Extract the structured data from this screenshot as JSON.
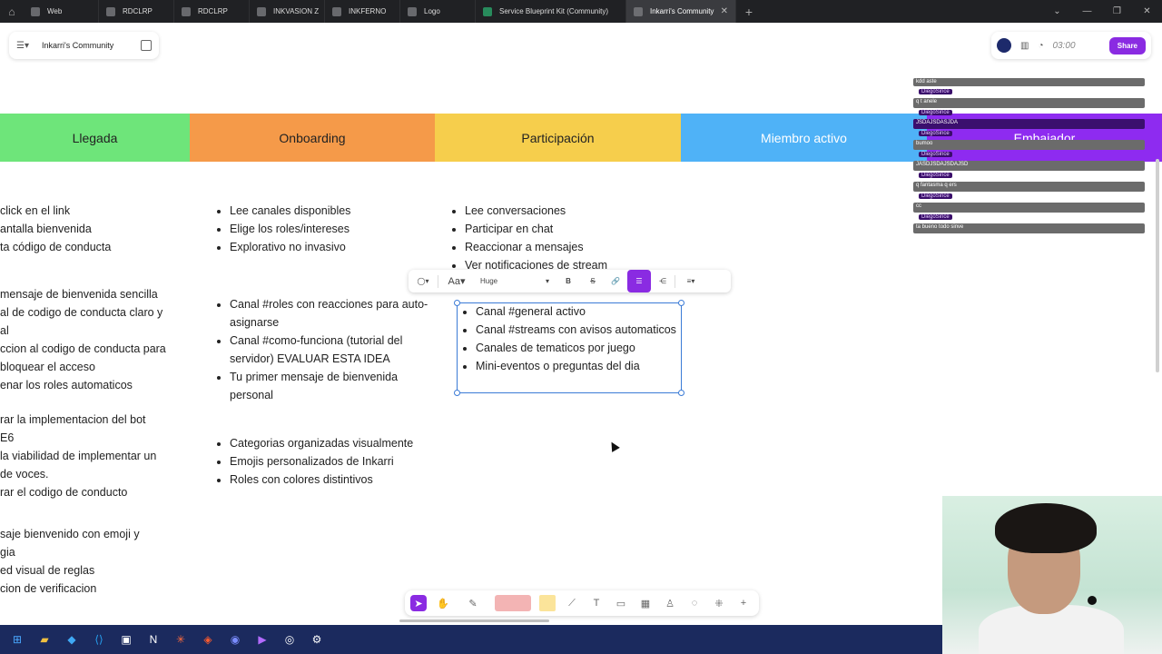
{
  "browser": {
    "tabs": [
      {
        "label": "Web"
      },
      {
        "label": "RDCLRP"
      },
      {
        "label": "RDCLRP"
      },
      {
        "label": "INKVASION Z"
      },
      {
        "label": "INKFERNO"
      },
      {
        "label": "Logo"
      },
      {
        "label": "Service Blueprint Kit (Community)"
      },
      {
        "label": "Inkarri's Community",
        "active": true
      }
    ],
    "new_tab": "+"
  },
  "header": {
    "doc_title": "Inkarri's Community",
    "timer": "03:00",
    "share_label": "Share"
  },
  "stages": [
    {
      "label": "Llegada",
      "color": "#6ee57a"
    },
    {
      "label": "Onboarding",
      "color": "#f59a49"
    },
    {
      "label": "Participación",
      "color": "#f6ce4c"
    },
    {
      "label": "Miembro activo",
      "color": "#4fb2f7"
    },
    {
      "label": "Embajador",
      "color": "#8e2bf0"
    }
  ],
  "llegada": {
    "group1": [
      "click en el link",
      "antalla bienvenida",
      "ta código de conducta"
    ],
    "group2": [
      "mensaje de bienvenida sencilla",
      "al de codigo de conducta claro y",
      "al",
      "ccion al codigo de conducta para",
      "bloquear el acceso",
      "enar los roles automaticos"
    ],
    "group3": [
      "rar la implementacion del bot",
      "E6",
      "la viabilidad de implementar un",
      "de voces.",
      "rar el codigo de conducto"
    ],
    "group4": [
      "saje bienvenido con emoji y",
      "gia",
      "ed visual de reglas",
      "cion de verificacion"
    ]
  },
  "onboarding": {
    "group1": [
      "Lee canales disponibles",
      "Elige los roles/intereses",
      "Explorativo no invasivo"
    ],
    "group2": [
      "Canal #roles con reacciones para auto-asignarse",
      "Canal #como-funciona (tutorial del servidor) EVALUAR ESTA IDEA",
      "Tu primer mensaje de bienvenida personal"
    ],
    "group3": [
      "Categorias organizadas visualmente",
      "Emojis personalizados de Inkarri",
      "Roles con colores distintivos"
    ]
  },
  "participacion": {
    "group1": [
      "Lee conversaciones",
      "Participar en chat",
      "Reaccionar a mensajes",
      "Ver notificaciones de stream"
    ],
    "group2": [
      "Canal #general activo",
      "Canal #streams con avisos automaticos",
      "Canales de tematicos por juego",
      "Mini-eventos o preguntas del dia"
    ]
  },
  "toolbar": {
    "font_label": "Aa",
    "size_label": "Huge",
    "bold": "B",
    "strike": "S"
  },
  "chat": {
    "messages": [
      {
        "user": "DiegoSince",
        "text": "q t anele"
      },
      {
        "user": "DiegoSince",
        "text": "JSDAJSDASJDA"
      },
      {
        "user": "DiegoSince",
        "text": "bumoo"
      },
      {
        "user": "DiegoSince",
        "text": "JASDJSDAJSDAJSD"
      },
      {
        "user": "DiegoSince",
        "text": "q fantasma q ers"
      },
      {
        "user": "DiegoSince",
        "text": "cc"
      },
      {
        "user": "DiegoSince",
        "text": "ta bueno todo sinve"
      }
    ],
    "top_text": "kdd aste"
  }
}
